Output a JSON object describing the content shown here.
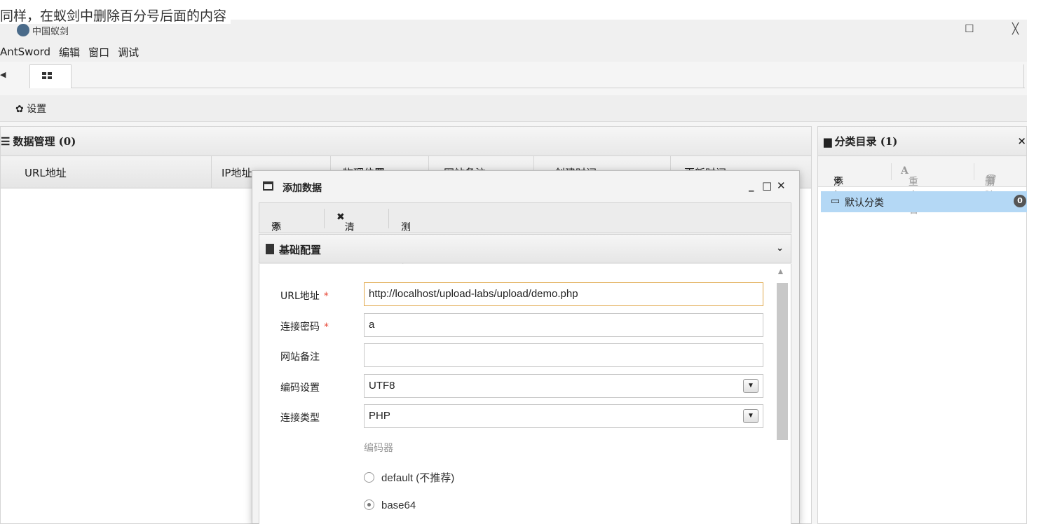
{
  "caption": "同样，在蚁剑中删除百分号后面的内容",
  "window": {
    "title": "中国蚁剑",
    "maximize": "☐",
    "close": "╳"
  },
  "menu": [
    "AntSword",
    "编辑",
    "窗口",
    "调试"
  ],
  "toolbar": {
    "settings_icon": "gear-icon",
    "settings_label": "设置"
  },
  "data_panel": {
    "title": "数据管理 (0)",
    "columns": [
      "URL地址",
      "IP地址",
      "物理位置",
      "网站备注",
      "创建时间",
      "更新时间"
    ]
  },
  "category_panel": {
    "title": "分类目录 (1)",
    "close": "×",
    "add_label": "添加",
    "rename_label": "重命名",
    "delete_label": "删除",
    "items": [
      {
        "label": "默认分类",
        "count": "0"
      }
    ]
  },
  "dialog": {
    "title": "添加数据",
    "controls": {
      "minimize": "_",
      "maximize": "□",
      "close": "✕"
    },
    "toolbar": {
      "add": "添加",
      "clear": "清空",
      "test": "测试连接"
    },
    "section_title": "基础配置",
    "form": {
      "url_label": "URL地址",
      "url_value": "http://localhost/upload-labs/upload/demo.php",
      "password_label": "连接密码",
      "password_value": "a",
      "note_label": "网站备注",
      "note_value": "",
      "encoding_label": "编码设置",
      "encoding_value": "UTF8",
      "type_label": "连接类型",
      "type_value": "PHP",
      "encoder_label": "编码器",
      "encoders": [
        {
          "label": "default (不推荐)",
          "checked": false
        },
        {
          "label": "base64",
          "checked": true
        }
      ],
      "required_mark": "*"
    }
  },
  "colors": {
    "accent_selected": "#b4d8f5",
    "required": "#e74c3c",
    "focus_border": "#e0a84c"
  }
}
